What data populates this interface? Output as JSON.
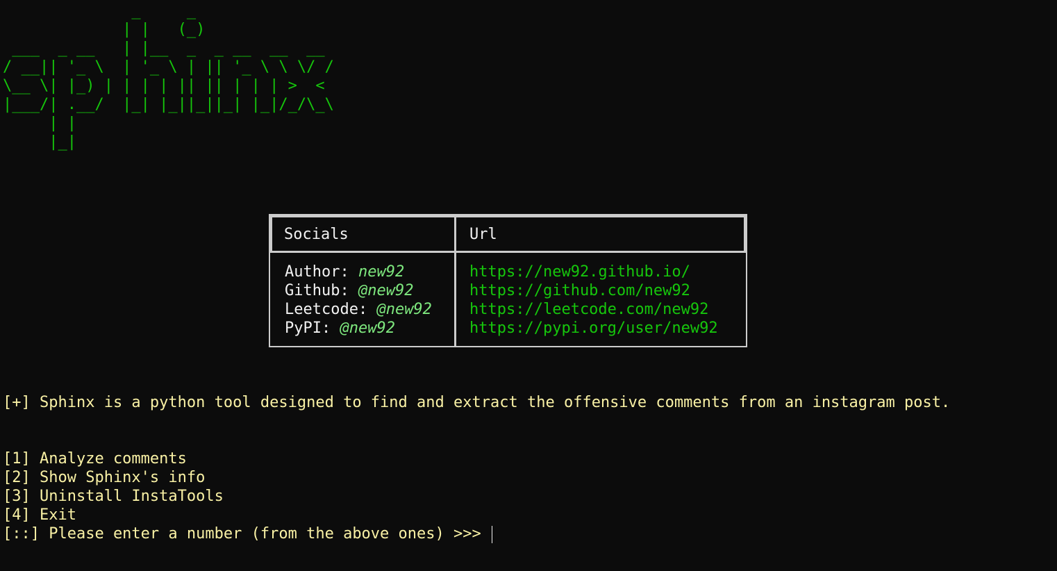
{
  "banner": {
    "ascii_art": "              _     _\n             | |   (_)\n ___  _ __   | |__  _  _ __  __  __\n/ __|| '_ \\  | '_ \\ | || '_ \\ \\ \\/ /\n\\__ \\| |_) | | | | || || | | | >  <\n|___/| .__/  |_| |_||_||_| |_|/_/\\_\\\n     | |\n     |_|",
    "color": "#16c60c"
  },
  "socials_table": {
    "headers": [
      "Socials",
      "Url"
    ],
    "rows": [
      {
        "label": "Author: ",
        "handle": "new92",
        "url": "https://new92.github.io/"
      },
      {
        "label": "Github: ",
        "handle": "@new92",
        "url": "https://github.com/new92"
      },
      {
        "label": "Leetcode: ",
        "handle": "@new92",
        "url": "https://leetcode.com/new92"
      },
      {
        "label": "PyPI: ",
        "handle": "@new92",
        "url": "https://pypi.org/user/new92"
      }
    ]
  },
  "description": "[+] Sphinx is a python tool designed to find and extract the offensive comments from an instagram post.",
  "menu": {
    "options": [
      "[1] Analyze comments",
      "[2] Show Sphinx's info",
      "[3] Uninstall InstaTools",
      "[4] Exit"
    ],
    "prompt": "[::] Please enter a number (from the above ones) >>> "
  },
  "colors": {
    "background": "#0c0c0c",
    "banner_green": "#16c60c",
    "handle_green": "#7ee87e",
    "text_yellow": "#f9f1a5",
    "border": "#cccccc"
  }
}
